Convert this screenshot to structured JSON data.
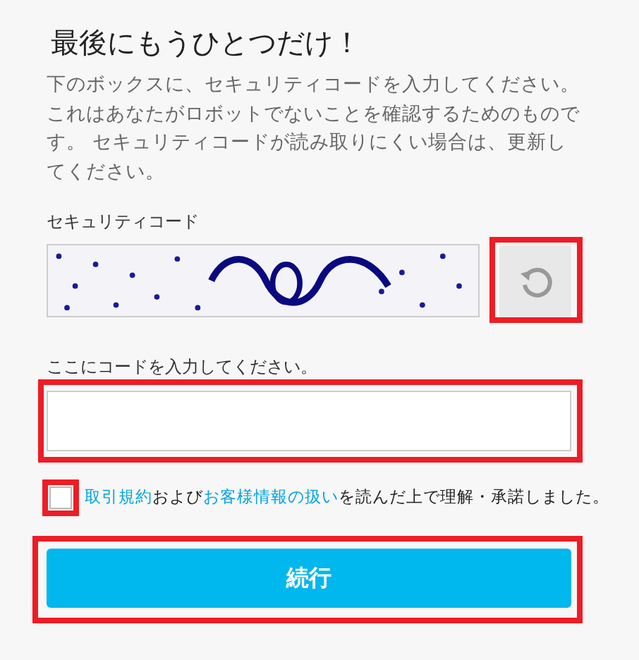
{
  "title": "最後にもうひとつだけ！",
  "description": "下のボックスに、セキュリティコードを入力してください。これはあなたがロボットでないことを確認するためのものです。 セキュリティコードが読み取りにくい場合は、更新してください。",
  "captcha": {
    "label": "セキュリティコード",
    "refresh": {
      "highlighted": true
    }
  },
  "code_input": {
    "label": "ここにコードを入力してください。",
    "highlighted": true
  },
  "agreement": {
    "checked": false,
    "highlighted": true,
    "parts": [
      {
        "kind": "link",
        "text": "取引規約"
      },
      {
        "kind": "text",
        "text": "および"
      },
      {
        "kind": "link",
        "text": "お客様情報の扱い"
      },
      {
        "kind": "text",
        "text": "を読んだ上で理解・承諾しました。"
      }
    ]
  },
  "continue_button": {
    "label": "続行",
    "highlighted": true
  }
}
